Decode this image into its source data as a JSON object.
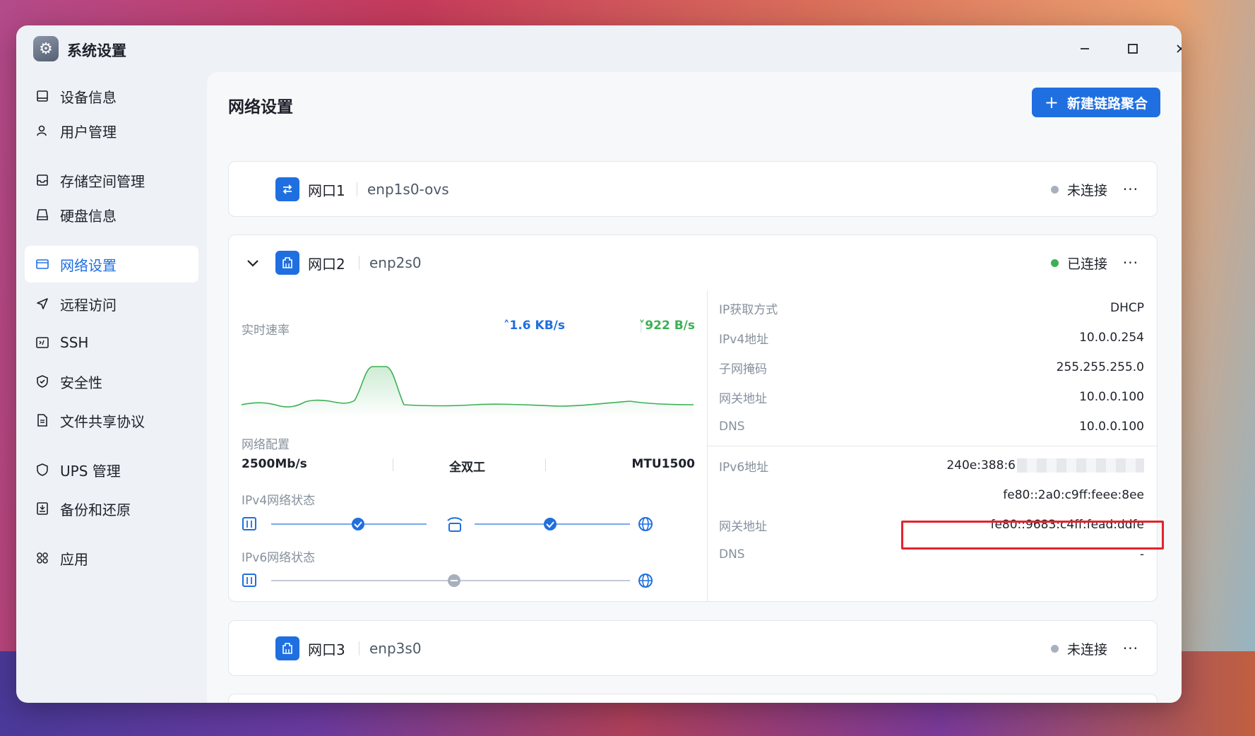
{
  "window": {
    "title": "系统设置"
  },
  "sidebar": {
    "items": [
      {
        "label": "设备信息",
        "icon": "monitor-icon"
      },
      {
        "label": "用户管理",
        "icon": "user-icon"
      },
      {
        "label": "存储空间管理",
        "icon": "storage-icon"
      },
      {
        "label": "硬盘信息",
        "icon": "disk-icon"
      },
      {
        "label": "网络设置",
        "icon": "network-icon",
        "active": true
      },
      {
        "label": "远程访问",
        "icon": "send-icon"
      },
      {
        "label": "SSH",
        "icon": "terminal-icon"
      },
      {
        "label": "安全性",
        "icon": "shield-check-icon"
      },
      {
        "label": "文件共享协议",
        "icon": "file-icon"
      },
      {
        "label": "UPS 管理",
        "icon": "shield-icon"
      },
      {
        "label": "备份和还原",
        "icon": "backup-icon"
      },
      {
        "label": "应用",
        "icon": "apps-icon"
      }
    ]
  },
  "main": {
    "title": "网络设置",
    "new_button": "新建链路聚合",
    "ports": [
      {
        "name": "网口1",
        "device": "enp1s0-ovs",
        "status": "未连接"
      },
      {
        "name": "网口2",
        "device": "enp2s0",
        "status": "已连接"
      },
      {
        "name": "网口3",
        "device": "enp3s0",
        "status": "未连接"
      }
    ],
    "detail": {
      "speed_label": "实时速率",
      "upload": "1.6 KB/s",
      "download": "922 B/s",
      "config_label": "网络配置",
      "link_speed": "2500Mb/s",
      "duplex": "全双工",
      "mtu": "MTU1500",
      "ipv4_status_label": "IPv4网络状态",
      "ipv6_status_label": "IPv6网络状态",
      "ipv4": [
        {
          "key": "IP获取方式",
          "value": "DHCP"
        },
        {
          "key": "IPv4地址",
          "value": "10.0.0.254"
        },
        {
          "key": "子网掩码",
          "value": "255.255.255.0"
        },
        {
          "key": "网关地址",
          "value": "10.0.0.100"
        },
        {
          "key": "DNS",
          "value": "10.0.0.100"
        }
      ],
      "ipv6_address_label": "IPv6地址",
      "ipv6_address_1": "240e:388:6",
      "ipv6_address_2": "fe80::2a0:c9ff:feee:8ee",
      "ipv6_gateway_label": "网关地址",
      "ipv6_gateway": "fe80::9683:c4ff:fead:ddfe",
      "ipv6_dns_label": "DNS",
      "ipv6_dns": "-"
    }
  },
  "colors": {
    "accent": "#1f6fe0",
    "connected": "#3cb055",
    "disconnected": "#a8b0bd",
    "highlight": "#e3242b"
  }
}
